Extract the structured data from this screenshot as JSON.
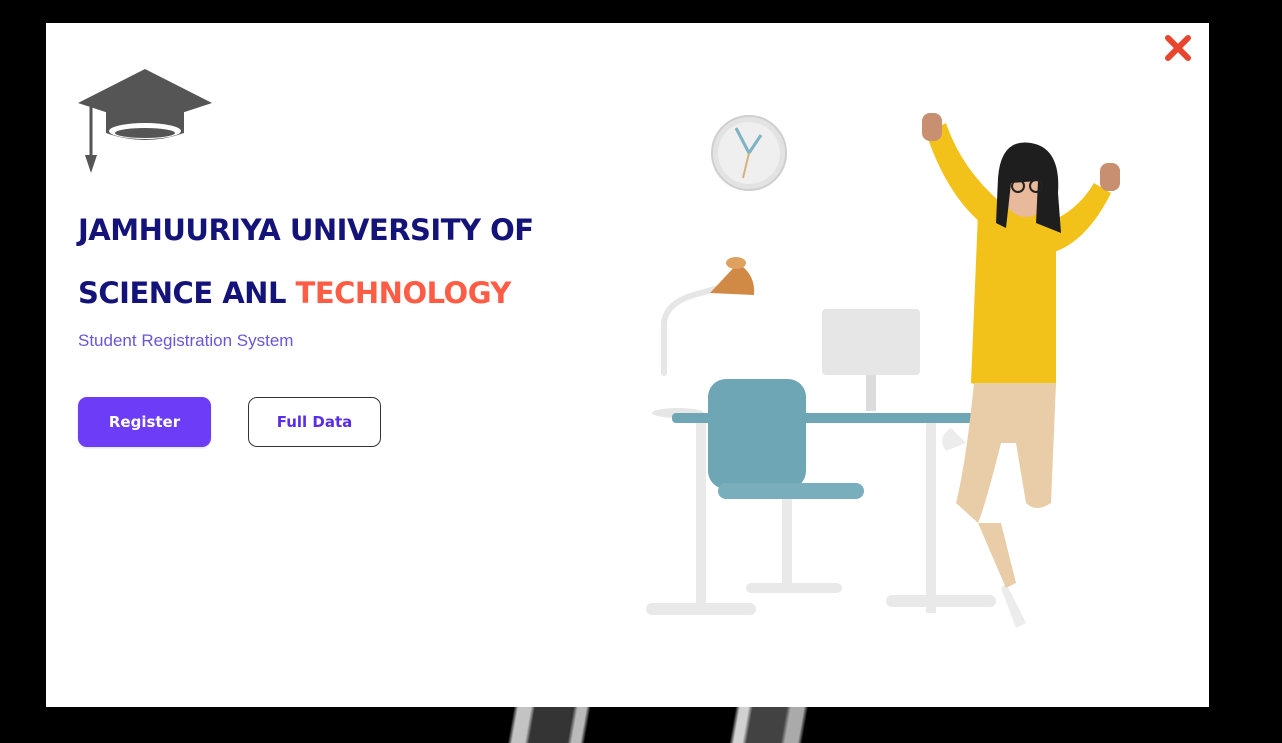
{
  "modal": {
    "close_icon": "close-icon",
    "accent_color": "#ff5c45",
    "brand_color": "#14137a",
    "primary_button_color": "#6c3cf6"
  },
  "hero": {
    "logo_icon": "graduation-cap-icon",
    "title_line1": "JAMHUURIYA UNIVERSITY OF",
    "title_line2_prefix": "SCIENCE ANL",
    "title_line2_accent": "TECHNOLOGY",
    "subtitle": "Student Registration System"
  },
  "actions": {
    "register_label": "Register",
    "full_data_label": "Full Data"
  },
  "illustration": {
    "icon": "student-desk-illustration"
  }
}
